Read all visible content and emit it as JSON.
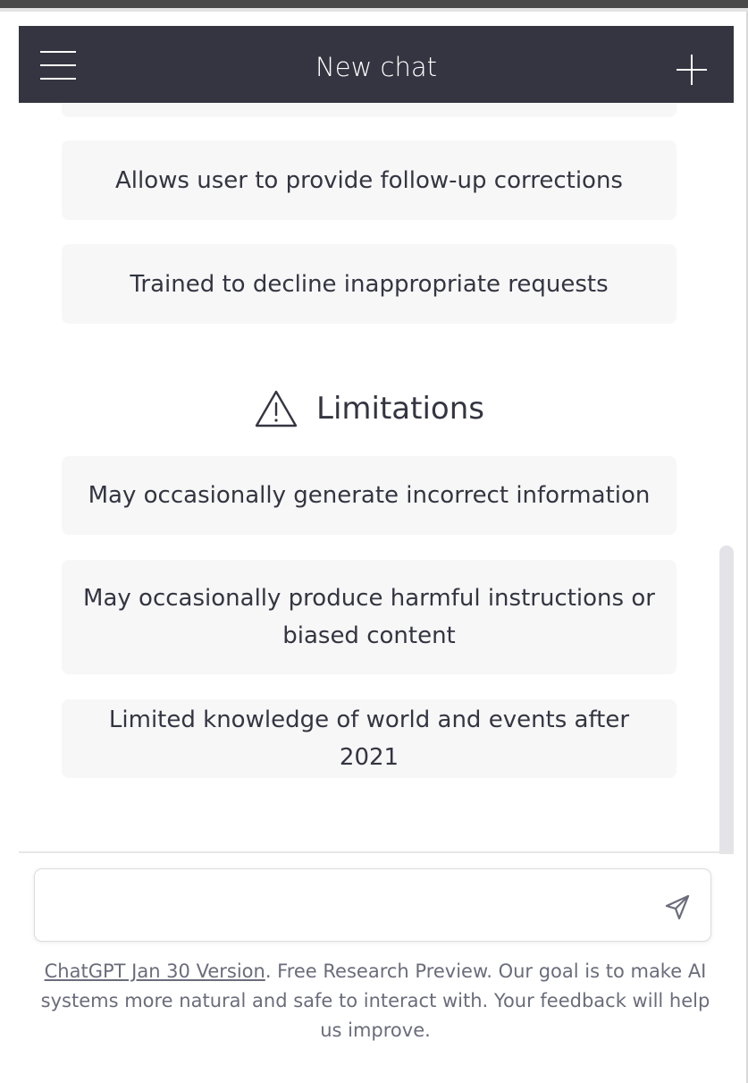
{
  "header": {
    "title": "New chat"
  },
  "capabilities": {
    "items": [
      "Allows user to provide follow-up corrections",
      "Trained to decline inappropriate requests"
    ]
  },
  "limitations": {
    "heading": "Limitations",
    "icon": "warning-triangle-icon",
    "items": [
      "May occasionally generate incorrect information",
      "May occasionally produce harmful instructions or biased content",
      "Limited knowledge of world and events after 2021"
    ]
  },
  "composer": {
    "value": "",
    "send_icon": "send-icon"
  },
  "footer": {
    "link_text": "ChatGPT Jan 30 Version",
    "text": ". Free Research Preview. Our goal is to make AI systems more natural and safe to interact with. Your feedback will help us improve."
  },
  "colors": {
    "header_bg": "#343541",
    "card_bg": "#f7f7f8",
    "text": "#343541",
    "footer_text": "#6b6c7b"
  }
}
